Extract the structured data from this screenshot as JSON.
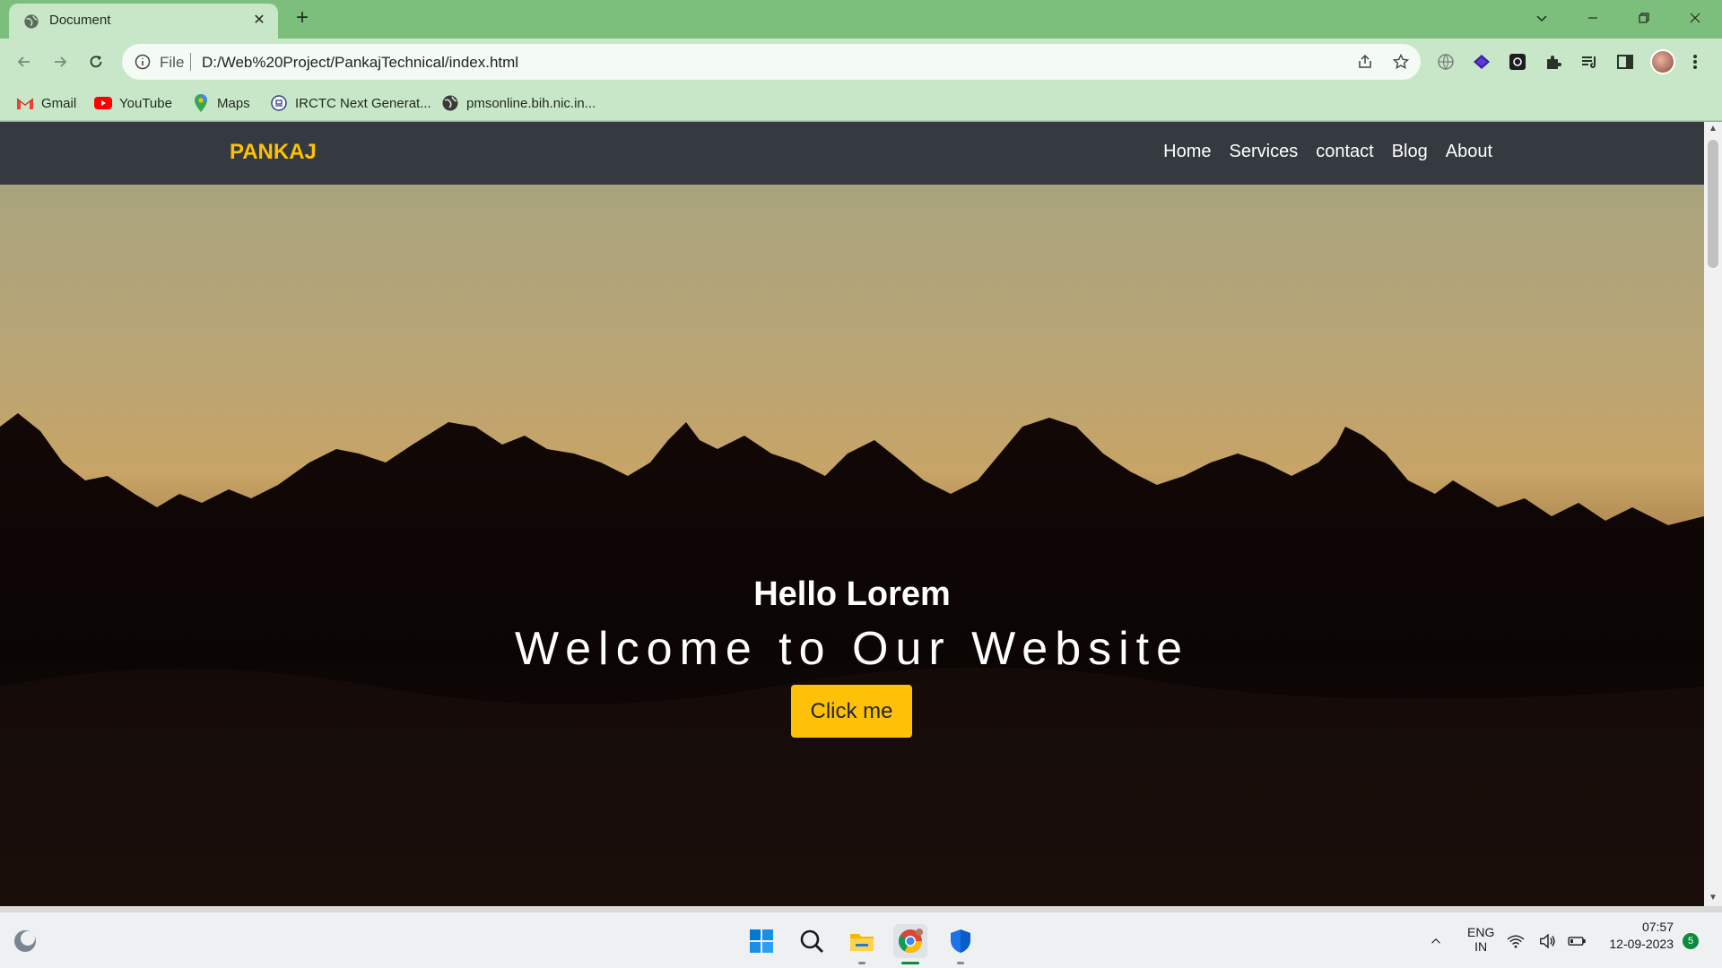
{
  "browser": {
    "tab": {
      "title": "Document",
      "close_glyph": "✕"
    },
    "new_tab_glyph": "+",
    "address": {
      "scheme": "File",
      "url": "D:/Web%20Project/PankajTechnical/index.html"
    },
    "bookmarks": [
      {
        "label": "Gmail",
        "icon": "gmail-icon"
      },
      {
        "label": "YouTube",
        "icon": "youtube-icon"
      },
      {
        "label": "Maps",
        "icon": "maps-icon"
      },
      {
        "label": "IRCTC Next Generat...",
        "icon": "irctc-icon"
      },
      {
        "label": "pmsonline.bih.nic.in...",
        "icon": "globe-icon"
      }
    ]
  },
  "site": {
    "brand": "PANKAJ",
    "nav": [
      "Home",
      "Services",
      "contact",
      "Blog",
      "About"
    ],
    "hero": {
      "greeting": "Hello Lorem",
      "headline": "Welcome to Our Website",
      "button": "Click me"
    }
  },
  "taskbar": {
    "language": {
      "line1": "ENG",
      "line2": "IN"
    },
    "time": "07:57",
    "date": "12-09-2023",
    "notification_count": "5"
  },
  "colors": {
    "tabstrip": "#7cbf7c",
    "toolbar": "#c8e6c8",
    "navbar": "#343a40",
    "brand": "#ffc107",
    "button": "#ffc107"
  }
}
